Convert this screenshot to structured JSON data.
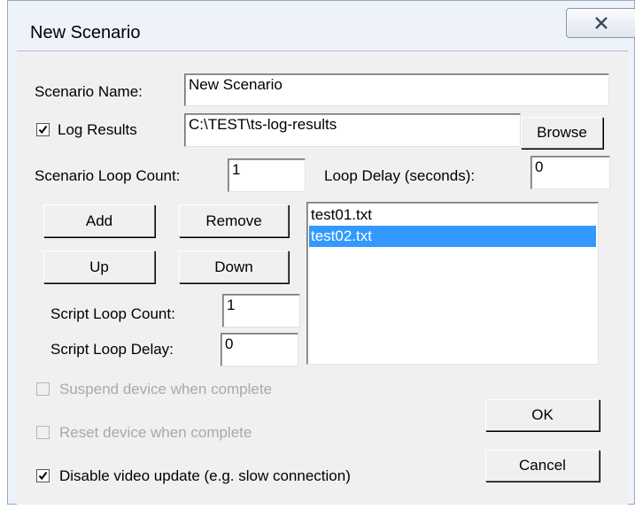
{
  "window": {
    "title": "New Scenario",
    "close_label": "X"
  },
  "scenario_name": {
    "label": "Scenario Name:",
    "value": "New Scenario"
  },
  "log_results": {
    "label": "Log Results",
    "checked": true,
    "path": "C:\\TEST\\ts-log-results",
    "browse_label": "Browse"
  },
  "scenario_loop_count": {
    "label": "Scenario Loop Count:",
    "value": "1"
  },
  "loop_delay": {
    "label": "Loop Delay (seconds):",
    "value": "0"
  },
  "buttons": {
    "add": "Add",
    "remove": "Remove",
    "up": "Up",
    "down": "Down",
    "ok": "OK",
    "cancel": "Cancel"
  },
  "script_list": {
    "items": [
      "test01.txt",
      "test02.txt"
    ],
    "selected_index": 1
  },
  "script_loop_count": {
    "label": "Script Loop Count:",
    "value": "1"
  },
  "script_loop_delay": {
    "label": "Script Loop Delay:",
    "value": "0"
  },
  "options": {
    "suspend": {
      "label": "Suspend device when complete",
      "checked": false,
      "enabled": false
    },
    "reset": {
      "label": "Reset device when complete",
      "checked": false,
      "enabled": false
    },
    "disable_video": {
      "label": "Disable video update (e.g. slow connection)",
      "checked": true,
      "enabled": true
    }
  },
  "colors": {
    "selection": "#3399ff",
    "frame": "#eef3fa",
    "face": "#f0f0f0"
  }
}
